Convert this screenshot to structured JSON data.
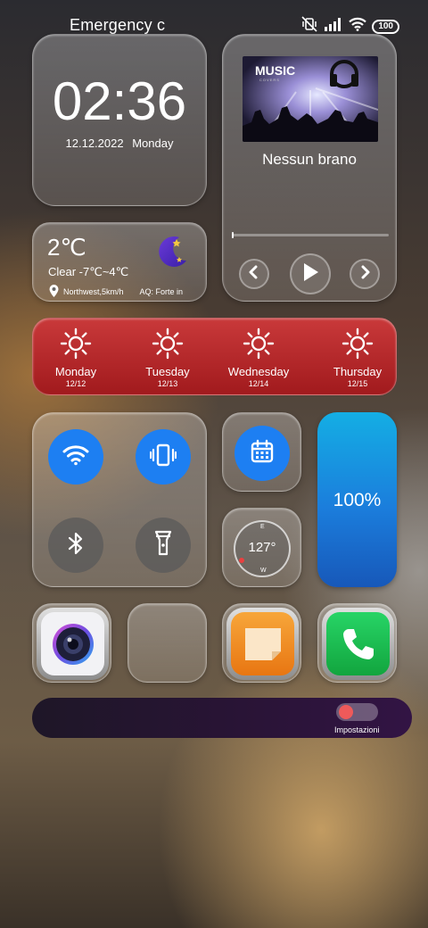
{
  "status_bar": {
    "carrier": "Emergency c",
    "battery": "100",
    "icons": [
      "mute-vibrate-icon",
      "signal-icon",
      "wifi-icon",
      "battery-icon"
    ]
  },
  "clock": {
    "time": "02:36",
    "date": "12.12.2022",
    "weekday": "Monday"
  },
  "music": {
    "album_title": "MUSIC",
    "album_subtitle": "COVERS",
    "track": "Nessun brano",
    "progress_fraction": 0.0,
    "controls": [
      "previous",
      "play",
      "next"
    ]
  },
  "weather": {
    "temperature": "2℃",
    "condition": "Clear -7℃~4℃",
    "wind": "Northwest,5km/h",
    "air_quality": "AQ: Forte in",
    "icon": "moon-icon"
  },
  "forecast": [
    {
      "day": "Monday",
      "date": "12/12",
      "icon": "sun-icon"
    },
    {
      "day": "Tuesday",
      "date": "12/13",
      "icon": "sun-icon"
    },
    {
      "day": "Wednesday",
      "date": "12/14",
      "icon": "sun-icon"
    },
    {
      "day": "Thursday",
      "date": "12/15",
      "icon": "sun-icon"
    }
  ],
  "toggles": [
    {
      "name": "wifi",
      "state": "on"
    },
    {
      "name": "vibrate",
      "state": "on"
    },
    {
      "name": "bluetooth",
      "state": "off"
    },
    {
      "name": "flashlight",
      "state": "off"
    }
  ],
  "compass": {
    "degrees": "127°",
    "east": "E",
    "west": "W"
  },
  "battery_widget": {
    "level": "100%"
  },
  "apps": [
    "camera",
    "empty",
    "notes",
    "phone"
  ],
  "settings": {
    "label": "Impostazioni",
    "switch_state": "off"
  },
  "colors": {
    "accent_blue": "#1d7ff2",
    "forecast_red": "#b8282a",
    "battery_blue": "#1b7ddc",
    "phone_green": "#18b64a",
    "notes_orange": "#f08a1a"
  }
}
